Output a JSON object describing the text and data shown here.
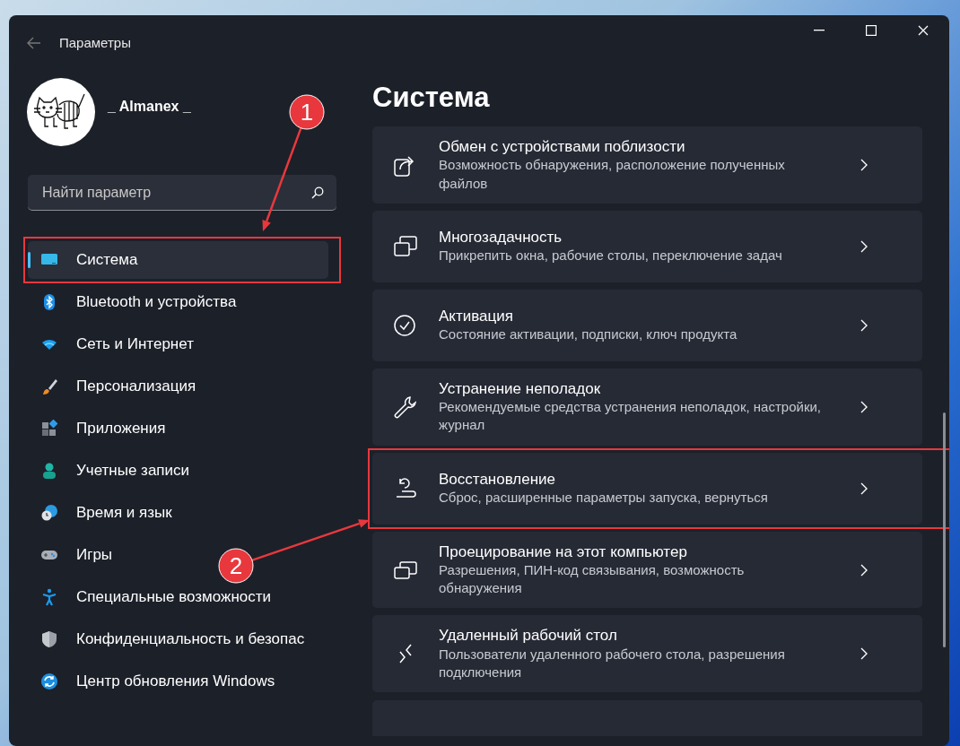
{
  "window": {
    "title": "Параметры"
  },
  "user": {
    "name": "_ Almanex _"
  },
  "search": {
    "placeholder": "Найти параметр"
  },
  "sidebar": {
    "items": [
      {
        "label": "Система",
        "selected": true,
        "highlighted": true
      },
      {
        "label": "Bluetooth и устройства",
        "selected": false,
        "highlighted": false
      },
      {
        "label": "Сеть и Интернет",
        "selected": false,
        "highlighted": false
      },
      {
        "label": "Персонализация",
        "selected": false,
        "highlighted": false
      },
      {
        "label": "Приложения",
        "selected": false,
        "highlighted": false
      },
      {
        "label": "Учетные записи",
        "selected": false,
        "highlighted": false
      },
      {
        "label": "Время и язык",
        "selected": false,
        "highlighted": false
      },
      {
        "label": "Игры",
        "selected": false,
        "highlighted": false
      },
      {
        "label": "Специальные возможности",
        "selected": false,
        "highlighted": false
      },
      {
        "label": "Конфиденциальность и безопас",
        "selected": false,
        "highlighted": false
      },
      {
        "label": "Центр обновления Windows",
        "selected": false,
        "highlighted": false
      }
    ]
  },
  "page": {
    "title": "Система"
  },
  "cards": [
    {
      "title": "Обмен с устройствами поблизости",
      "subtitle": "Возможность обнаружения, расположение полученных файлов",
      "highlighted": false
    },
    {
      "title": "Многозадачность",
      "subtitle": "Прикрепить окна, рабочие столы, переключение задач",
      "highlighted": false
    },
    {
      "title": "Активация",
      "subtitle": "Состояние активации, подписки, ключ продукта",
      "highlighted": false
    },
    {
      "title": "Устранение неполадок",
      "subtitle": "Рекомендуемые средства устранения неполадок, настройки, журнал",
      "highlighted": false
    },
    {
      "title": "Восстановление",
      "subtitle": "Сброс, расширенные параметры запуска, вернуться",
      "highlighted": true
    },
    {
      "title": "Проецирование на этот компьютер",
      "subtitle": "Разрешения, ПИН-код связывания, возможность обнаружения",
      "highlighted": false
    },
    {
      "title": "Удаленный рабочий стол",
      "subtitle": "Пользователи удаленного рабочего стола, разрешения подключения",
      "highlighted": false
    }
  ],
  "annotations": [
    {
      "label": "1"
    },
    {
      "label": "2"
    }
  ]
}
